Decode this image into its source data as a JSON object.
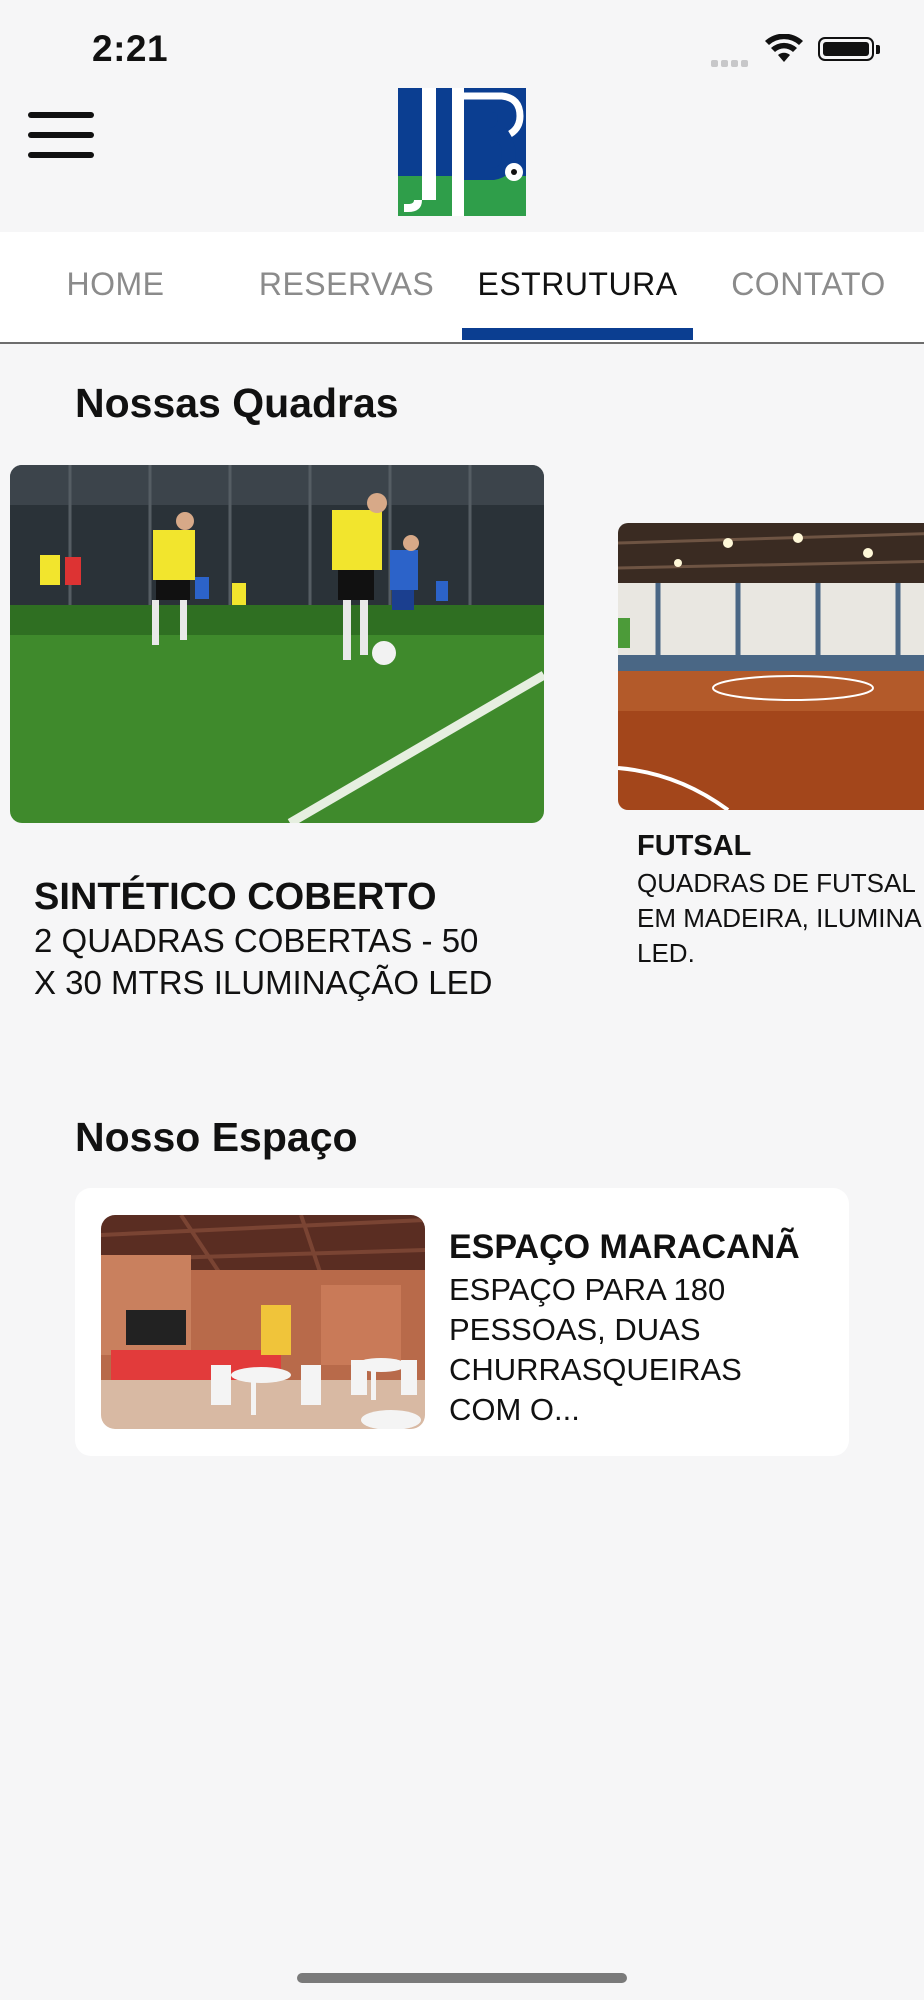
{
  "status_bar": {
    "time": "2:21"
  },
  "header": {
    "menu_icon": "hamburger-menu-icon",
    "logo_icon": "jb-logo-icon"
  },
  "tabs": [
    {
      "label": "HOME"
    },
    {
      "label": "RESERVAS"
    },
    {
      "label": "ESTRUTURA",
      "active": true
    },
    {
      "label": "CONTATO"
    }
  ],
  "colors": {
    "accent": "#0b3e91",
    "logo_green": "#2f9e4a",
    "background": "#f6f6f7"
  },
  "quadras": {
    "title": "Nossas Quadras",
    "items": [
      {
        "title": "SINTÉTICO COBERTO",
        "desc_line1": "2 QUADRAS COBERTAS - 50",
        "desc_line2": "X 30 MTRS ILUMINAÇÃO LED"
      },
      {
        "title": "FUTSAL",
        "desc_line1": "QUADRAS DE FUTSAL",
        "desc_line2": "EM MADEIRA, ILUMINA",
        "desc_line3": "LED."
      }
    ]
  },
  "espaco": {
    "title": "Nosso Espaço",
    "items": [
      {
        "title": "ESPAÇO MARACANÃ",
        "desc_line1": "ESPAÇO PARA 180",
        "desc_line2": "PESSOAS, DUAS",
        "desc_line3": "CHURRASQUEIRAS",
        "desc_line4": "COM O..."
      }
    ]
  }
}
